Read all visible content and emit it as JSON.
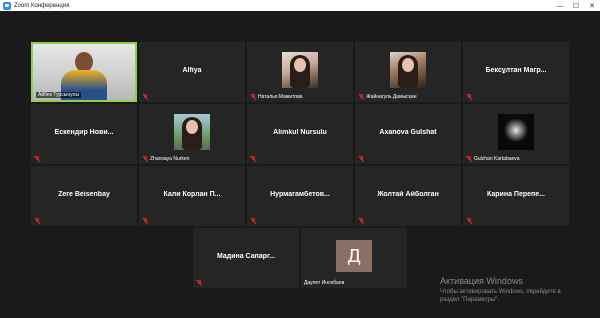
{
  "window": {
    "title": "Zoom Конференция",
    "controls": {
      "minimize": "—",
      "maximize": "☐",
      "close": "✕"
    }
  },
  "tiles": [
    {
      "name": "",
      "label": "Айбек Турсынулы",
      "video": true,
      "active": true,
      "muted": false
    },
    {
      "name": "Alfiya",
      "label": "",
      "muted": true
    },
    {
      "name": "",
      "label": "Наталья Мажитова",
      "muted": true,
      "thumb": "portrait1"
    },
    {
      "name": "",
      "label": "Жайнагуль Дамыскан",
      "muted": true,
      "thumb": "portrait2"
    },
    {
      "name": "Бексұлтан Магр...",
      "label": "",
      "muted": true
    },
    {
      "name": "Ескендир Нови...",
      "label": "",
      "muted": true
    },
    {
      "name": "",
      "label": "Zhansaya Nurken",
      "muted": true,
      "thumb": "portrait3"
    },
    {
      "name": "Alimkul Nursulu",
      "label": "",
      "muted": true
    },
    {
      "name": "Axanova Gulshat",
      "label": "",
      "muted": true
    },
    {
      "name": "",
      "label": "Gulzhan Kartabaeva",
      "muted": true,
      "thumb": "portrait4"
    },
    {
      "name": "Zere Beisenbay",
      "label": "",
      "muted": true
    },
    {
      "name": "Кали Корлан П...",
      "label": "",
      "muted": true
    },
    {
      "name": "Нурмагамбетов...",
      "label": "",
      "muted": true
    },
    {
      "name": "Жолтай Айболган",
      "label": "",
      "muted": true
    },
    {
      "name": "Карина Перепе...",
      "label": "",
      "muted": true
    },
    {
      "name": "Мадина Сапарг...",
      "label": "",
      "muted": true
    },
    {
      "name": "",
      "label": "Даулет Инсебаев",
      "muted": false,
      "initial": "Д"
    }
  ],
  "watermark": {
    "title": "Активация Windows",
    "line1": "Чтобы активировать Windows, перейдите в",
    "line2": "раздел \"Параметры\"."
  },
  "colors": {
    "active_border": "#8fd14f",
    "mute_red": "#e02828",
    "tile_bg": "#252525"
  },
  "icons": {
    "mute": "microphone-muted-icon",
    "app": "zoom-logo-icon"
  }
}
